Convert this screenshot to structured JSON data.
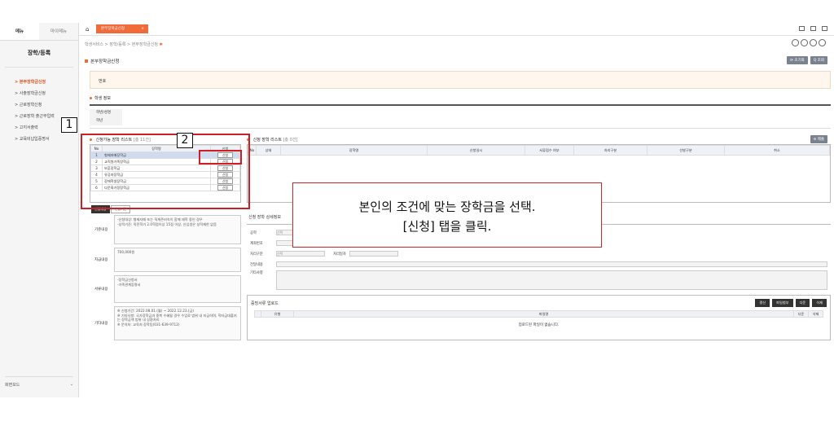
{
  "sidebar": {
    "tabs": [
      "메뉴",
      "마이메뉴"
    ],
    "title": "장학/등록",
    "items": [
      "> 본부장학금신청",
      "> 사출장학금신청",
      "> 근로장학신청",
      "> 근로장학 출근부입력",
      "> 고지서출력",
      "> 교육비납입증명서"
    ],
    "footer_label": "화면모드",
    "footer_chevron": "⌄"
  },
  "topbar": {
    "tab_label": "본부장학금신청",
    "tab_close": "×",
    "home": "⌂"
  },
  "breadcrumb": "학생서비스 > 장학/등록 > 본부장학금신청",
  "page_title": "본부장학금신청",
  "header_buttons": [
    "⟳ 초기화",
    "Q 조회"
  ],
  "notice_label": "번호",
  "student_section": {
    "title": "학생 정보",
    "rows": [
      "학번/성명",
      "학년"
    ]
  },
  "left_list": {
    "title": "신청가능 장학 리스트",
    "count": "[총 11건]",
    "columns": [
      "No",
      "장학명",
      "신청"
    ],
    "rows": [
      {
        "no": "1",
        "name": "형제자매장학금",
        "apply": "신청"
      },
      {
        "no": "2",
        "name": "교직원가족장학금",
        "apply": "신청"
      },
      {
        "no": "3",
        "name": "보훈장학금",
        "apply": "신청"
      },
      {
        "no": "4",
        "name": "유공자장학금",
        "apply": "신청"
      },
      {
        "no": "5",
        "name": "장애학생장학금",
        "apply": "신청"
      },
      {
        "no": "6",
        "name": "다문화가정장학금",
        "apply": "신청"
      }
    ],
    "sub_buttons": [
      "신청대상",
      "신청기간"
    ]
  },
  "right_list": {
    "title": "신청 장학 리스트",
    "count": "[총 0건]",
    "button": "⊖ 제출",
    "columns": [
      "No",
      "상태",
      "장학명",
      "신청일시",
      "서류접수 여부",
      "처리구분",
      "선발구분",
      "취소"
    ]
  },
  "detail_left": [
    {
      "label": "기준내용",
      "value": "-신청대상: 형제자매 또는 직계존비속이 함께 재학 중인 경우\n-성적기준: 직전학기 2.0학점이상 15점 이상, 신입생은 성적제한 없음"
    },
    {
      "label": "지급내용",
      "value": "700,000원"
    },
    {
      "label": "서류내용",
      "value": "-장학금신청서\n-가족관계증명서"
    },
    {
      "label": "기타내용",
      "value": "※ 신청기간: 2022.08.01.(월) ~ 2022.12.23.(금)\n※ 기타사항: 국가장학금과 중복 수혜될 경우 수업료 범위 내 지급하며, 학자금대출지는 장학금액 범위 내 상환처리\n※ 문의처: 교육처 장학팀(031-639-9712)"
    }
  ],
  "detail_right": {
    "title": "신청 장학 상세정보",
    "fields": [
      "공학",
      "계좌번호",
      "처리구분",
      "전달내용",
      "기타사항"
    ],
    "select_placeholder": "선택",
    "process_date_label": "처리일자"
  },
  "upload": {
    "title": "증빙서류 업로드",
    "buttons": [
      "갱신",
      "파일첨부",
      "다운",
      "삭제"
    ],
    "columns": [
      "",
      "유형",
      "파일명",
      "다운",
      "삭제"
    ],
    "empty": "업로드된 파일이 없습니다."
  },
  "callout": {
    "line1": "본인의 조건에 맞는 장학금을 선택.",
    "line2": "[신청] 탭을 클릭."
  },
  "markers": [
    "1",
    "2"
  ],
  "colors": {
    "accent": "#f06a3a",
    "highlight": "#d01e25"
  }
}
